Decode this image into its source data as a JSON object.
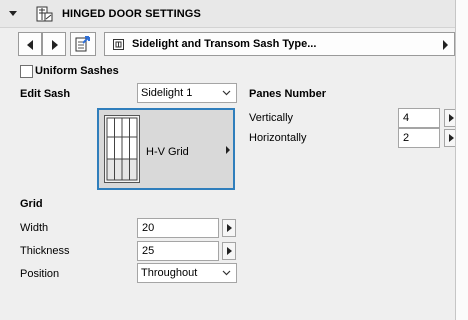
{
  "header": {
    "title": "HINGED DOOR SETTINGS",
    "collapse_icon": "triangle-down-icon",
    "icon": "door-settings-icon"
  },
  "navbar": {
    "prev_icon": "triangle-left-icon",
    "next_icon": "triangle-right-icon",
    "favorites_icon": "favorites-arrow-icon",
    "type_icon": "grid-square-icon",
    "type_label": "Sidelight and Transom Sash Type..."
  },
  "uniform_sashes": {
    "label": "Uniform Sashes",
    "checked": false
  },
  "edit_sash": {
    "label": "Edit Sash",
    "value": "Sidelight 1"
  },
  "preview": {
    "label": "H-V Grid"
  },
  "panes": {
    "title": "Panes Number",
    "vertically": {
      "label": "Vertically",
      "value": "4"
    },
    "horizontally": {
      "label": "Horizontally",
      "value": "2"
    }
  },
  "grid": {
    "title": "Grid",
    "width": {
      "label": "Width",
      "value": "20"
    },
    "thickness": {
      "label": "Thickness",
      "value": "25"
    },
    "position": {
      "label": "Position",
      "value": "Throughout"
    }
  },
  "colors": {
    "accent": "#2f7ebc",
    "favorites": "#2f6fd6"
  }
}
